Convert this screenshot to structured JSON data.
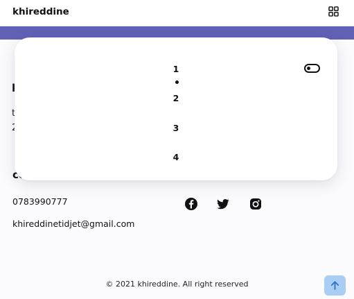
{
  "header": {
    "brand": "khireddine",
    "menu_icon": "grid-icon"
  },
  "colors": {
    "accent": "#6161b6",
    "scroll_button": "#a9cdf3",
    "background": "#fbfbfd"
  },
  "nav_menu": {
    "items": [
      "1",
      "2",
      "3",
      "4"
    ],
    "toggle_icon": "toggle-switch-icon"
  },
  "footer": {
    "partial_heading": "k",
    "partial_line1": "t",
    "partial_line2": "2",
    "contact_heading": "co",
    "phone": "0783990777",
    "email": "khireddinetidjet@gmail.com",
    "social": [
      "facebook-icon",
      "twitter-icon",
      "instagram-icon"
    ],
    "copyright": "© 2021 khireddine. All right reserved"
  },
  "scroll_top": {
    "icon": "arrow-up-icon"
  }
}
